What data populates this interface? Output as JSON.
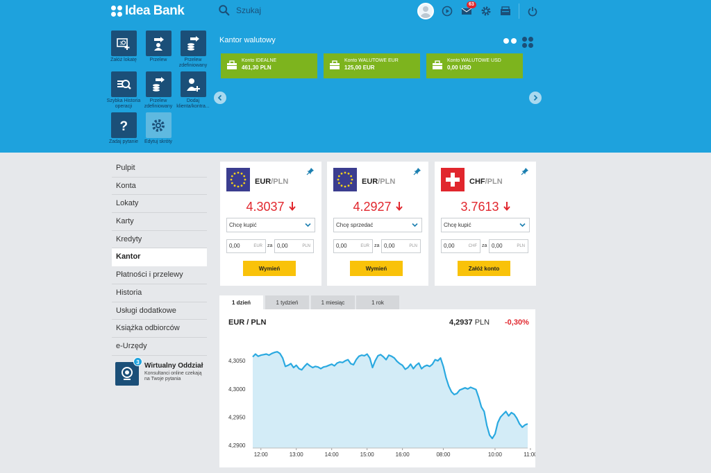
{
  "app": {
    "logo_text": "Idea Bank"
  },
  "topbar": {
    "search_placeholder": "Szukaj",
    "mail_count": "63"
  },
  "shortcuts": [
    {
      "label": "Załóż lokatę",
      "icon": "deposit-icon"
    },
    {
      "label": "Przelew",
      "icon": "transfer-icon"
    },
    {
      "label": "Przelew zdefiniowany",
      "icon": "defined-transfer-icon"
    },
    {
      "label": "Szybka Historia operacji",
      "icon": "history-search-icon"
    },
    {
      "label": "Przelew zdefiniowany",
      "icon": "defined-transfer-icon"
    },
    {
      "label": "Dodaj klienta/kontra...",
      "icon": "add-client-icon"
    },
    {
      "label": "Zadaj pytanie",
      "icon": "question-icon"
    },
    {
      "label": "Edytuj skróty",
      "icon": "gear-icon"
    }
  ],
  "kantor": {
    "title": "Kantor walutowy",
    "accounts": [
      {
        "name": "Konto IDEALNE",
        "value": "461,30 PLN"
      },
      {
        "name": "Konto WALUTOWE EUR",
        "value": "125,00 EUR"
      },
      {
        "name": "Konto WALUTOWE USD",
        "value": "0,00 USD"
      }
    ]
  },
  "nav": {
    "items": [
      "Pulpit",
      "Konta",
      "Lokaty",
      "Karty",
      "Kredyty",
      "Kantor",
      "Płatności i przelewy",
      "Historia",
      "Usługi dodatkowe",
      "Książka odbiorców",
      "e-Urzędy"
    ],
    "active": "Kantor"
  },
  "virtual_branch": {
    "title": "Wirtualny Oddział",
    "subtitle": "Konsultanci online czekają na Twoje pytania",
    "badge": "3"
  },
  "cards": [
    {
      "base": "EUR",
      "quote": "/PLN",
      "rate": "4.3037",
      "select": "Chcę kupić",
      "in1": "0,00",
      "unit1": "EUR",
      "za": "za",
      "in2": "0,00",
      "unit2": "PLN",
      "button": "Wymień",
      "flag": "eu-flag-icon"
    },
    {
      "base": "EUR",
      "quote": "/PLN",
      "rate": "4.2927",
      "select": "Chcę sprzedać",
      "in1": "0,00",
      "unit1": "EUR",
      "za": "za",
      "in2": "0,00",
      "unit2": "PLN",
      "button": "Wymień",
      "flag": "eu-flag-icon"
    },
    {
      "base": "CHF",
      "quote": "/PLN",
      "rate": "3.7613",
      "select": "Chcę kupić",
      "in1": "0,00",
      "unit1": "CHF",
      "za": "za",
      "in2": "0,00",
      "unit2": "PLN",
      "button": "Załóż konto",
      "flag": "swiss-flag-icon"
    }
  ],
  "tabs": [
    "1 dzień",
    "1 tydzień",
    "1 miesiąc",
    "1 rok"
  ],
  "active_tab": "1 dzień",
  "chart_header": {
    "pair": "EUR / PLN",
    "price": "4,2937",
    "currency": "PLN",
    "change": "-0,30%"
  },
  "colors": {
    "brand_blue": "#1ea2dd",
    "dark_blue": "#1b4f78",
    "green": "#7db41e",
    "yellow": "#f9c20a",
    "red": "#e1262d",
    "line": "#2aa9e0",
    "area": "#d3ecf7"
  },
  "chart_data": {
    "type": "area",
    "title": "EUR / PLN",
    "xlabel": "",
    "ylabel": "",
    "y_ticks": [
      "4,3050",
      "4,3000",
      "4,2950",
      "4,2900"
    ],
    "y_tick_values": [
      4.305,
      4.3,
      4.295,
      4.29
    ],
    "x_ticks": [
      "12:00",
      "13:00",
      "14:00",
      "15:00",
      "16:00",
      "08:00",
      "10:00",
      "11:00"
    ],
    "x_tick_index": [
      3,
      16,
      29,
      42,
      55,
      70,
      89,
      102
    ],
    "ylim": [
      4.2895,
      4.307
    ],
    "series": [
      {
        "values": [
          4.3057,
          4.3062,
          4.3058,
          4.306,
          4.3061,
          4.3062,
          4.306,
          4.3063,
          4.3065,
          4.3066,
          4.3063,
          4.3055,
          4.304,
          4.3042,
          4.3045,
          4.3038,
          4.3042,
          4.3036,
          4.3034,
          4.304,
          4.3045,
          4.3041,
          4.3038,
          4.304,
          4.3039,
          4.3036,
          4.3039,
          4.304,
          4.3042,
          4.3044,
          4.3041,
          4.3046,
          4.3048,
          4.3047,
          4.305,
          4.3052,
          4.3045,
          4.3043,
          4.3052,
          4.3058,
          4.306,
          4.3059,
          4.3062,
          4.3055,
          4.3038,
          4.305,
          4.3059,
          4.3061,
          4.3057,
          4.3052,
          4.306,
          4.3058,
          4.3055,
          4.3049,
          4.3045,
          4.3042,
          4.3035,
          4.3038,
          4.3044,
          4.3036,
          4.3042,
          4.3046,
          4.3036,
          4.304,
          4.3042,
          4.304,
          4.3044,
          4.3052,
          4.305,
          4.3055,
          4.304,
          4.302,
          4.3005,
          4.2995,
          4.299,
          4.2992,
          4.2998,
          4.3,
          4.3002,
          4.3,
          4.3003,
          4.3001,
          4.2999,
          4.2985,
          4.2968,
          4.296,
          4.2935,
          4.2918,
          4.2912,
          4.292,
          4.294,
          4.295,
          4.2955,
          4.296,
          4.2952,
          4.2958,
          4.2955,
          4.2948,
          4.2938,
          4.2932,
          4.2936,
          4.2938
        ]
      }
    ],
    "grid": false
  }
}
